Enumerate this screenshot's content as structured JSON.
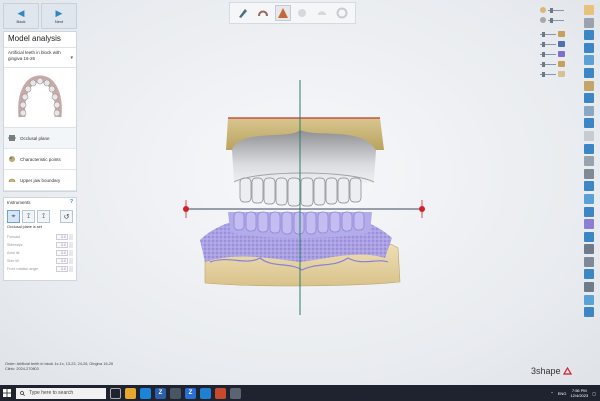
{
  "nav": {
    "back_label": "Back",
    "next_label": "Next"
  },
  "panel": {
    "title": "Model analysis",
    "model_select": "Artificial teeth in block with gingiva 16-26",
    "steps": [
      {
        "label": "Occlusal plane",
        "icon": "occlusal-plane-icon"
      },
      {
        "label": "Characteristic points",
        "icon": "characteristic-points-icon"
      },
      {
        "label": "Upper jaw boundary",
        "icon": "jaw-boundary-icon"
      }
    ]
  },
  "instruments": {
    "title": "Instruments",
    "caption": "Occlusal plane is set",
    "params": [
      {
        "name": "Forward",
        "value": "0.0"
      },
      {
        "name": "Sideways",
        "value": "0.0"
      },
      {
        "name": "Axial tilt",
        "value": "0.0"
      },
      {
        "name": "Side tilt",
        "value": "0.0"
      },
      {
        "name": "Front rotation angle",
        "value": "0.0"
      }
    ]
  },
  "status": {
    "order": "Order: Artificial teeth in block 1x-1x, 13-23, 24-26, Gingiva 16-26",
    "clinic": "Clinic: 2024-270803"
  },
  "brand": {
    "name": "3shape"
  },
  "taskbar": {
    "search_placeholder": "Type here to search",
    "language": "ENG",
    "time": "7:56 PM",
    "date": "12/4/2023"
  },
  "colors": {
    "accent": "#2f86c7",
    "gingiva": "#9a92e0",
    "crosshair_axis": "#2e7d6a",
    "handle": "#d0202a"
  }
}
